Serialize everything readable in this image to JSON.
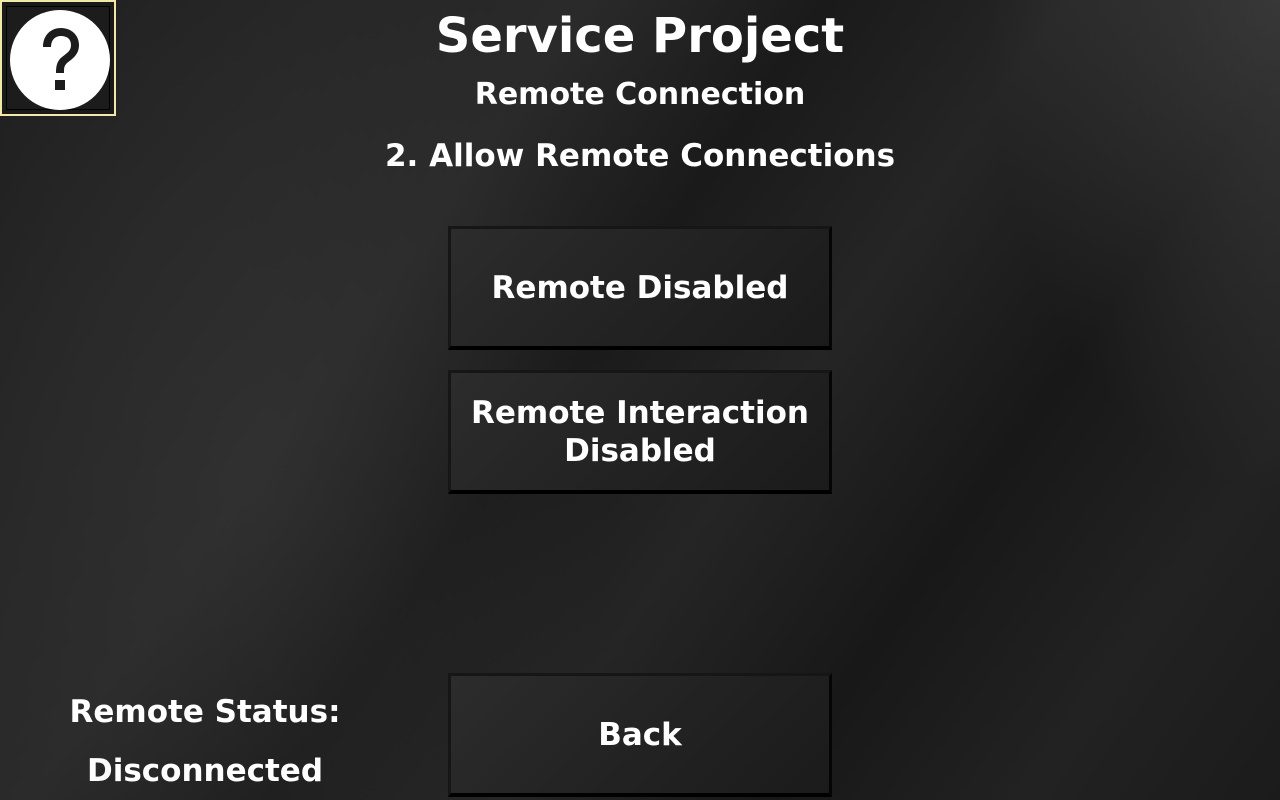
{
  "header": {
    "title": "Service Project",
    "subtitle": "Remote Connection",
    "step": "2. Allow Remote Connections"
  },
  "help_button": {
    "icon": "question-mark-icon",
    "border_color": "#f2e9a8"
  },
  "buttons": {
    "remote_label": "Remote Disabled",
    "interaction_label_line1": "Remote Interaction",
    "interaction_label_line2": "Disabled",
    "back_label": "Back"
  },
  "status": {
    "label": "Remote Status:",
    "value": "Disconnected"
  }
}
